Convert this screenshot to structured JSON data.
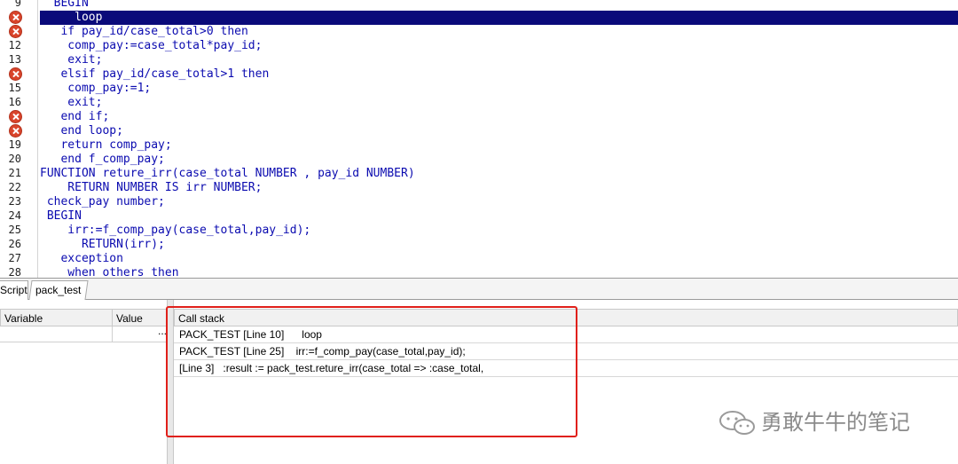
{
  "editor": {
    "gutter": [
      {
        "line": "9",
        "breakpoint": false
      },
      {
        "line": "",
        "breakpoint": true
      },
      {
        "line": "",
        "breakpoint": true
      },
      {
        "line": "12",
        "breakpoint": false
      },
      {
        "line": "13",
        "breakpoint": false
      },
      {
        "line": "",
        "breakpoint": true
      },
      {
        "line": "15",
        "breakpoint": false
      },
      {
        "line": "16",
        "breakpoint": false
      },
      {
        "line": "",
        "breakpoint": true
      },
      {
        "line": "",
        "breakpoint": true
      },
      {
        "line": "19",
        "breakpoint": false
      },
      {
        "line": "20",
        "breakpoint": false
      },
      {
        "line": "21",
        "breakpoint": false
      },
      {
        "line": "22",
        "breakpoint": false
      },
      {
        "line": "23",
        "breakpoint": false
      },
      {
        "line": "24",
        "breakpoint": false
      },
      {
        "line": "25",
        "breakpoint": false
      },
      {
        "line": "26",
        "breakpoint": false
      },
      {
        "line": "27",
        "breakpoint": false
      },
      {
        "line": "28",
        "breakpoint": false
      }
    ],
    "lines": [
      "  BEGIN",
      "     loop",
      "   if pay_id/case_total>0 then",
      "    comp_pay:=case_total*pay_id;",
      "    exit;",
      "   elsif pay_id/case_total>1 then",
      "    comp_pay:=1;",
      "    exit;",
      "   end if;",
      "   end loop;",
      "   return comp_pay;",
      "   end f_comp_pay;",
      "FUNCTION reture_irr(case_total NUMBER , pay_id NUMBER)",
      "    RETURN NUMBER IS irr NUMBER;",
      " check_pay number;",
      " BEGIN",
      "    irr:=f_comp_pay(case_total,pay_id);",
      "      RETURN(irr);",
      "   exception",
      "    when others then"
    ],
    "active_line_index": 1,
    "colors": {
      "code_text": "#0b0bb0",
      "active_line_bg": "#0a0a7a",
      "breakpoint": "#d9442b"
    }
  },
  "tabs": [
    {
      "label": "Script"
    },
    {
      "label": "pack_test"
    }
  ],
  "variables_panel": {
    "col_variable": "Variable",
    "col_value": "Value",
    "ellipsis": "..."
  },
  "call_stack": {
    "title": "Call stack",
    "rows": [
      "PACK_TEST [Line 10]      loop",
      "PACK_TEST [Line 25]    irr:=f_comp_pay(case_total,pay_id);",
      "[Line 3]   :result := pack_test.reture_irr(case_total => :case_total,"
    ]
  },
  "annotation": {
    "color": "#e0201a"
  },
  "watermark": {
    "text": "勇敢牛牛的笔记",
    "icon": "wechat-icon"
  }
}
